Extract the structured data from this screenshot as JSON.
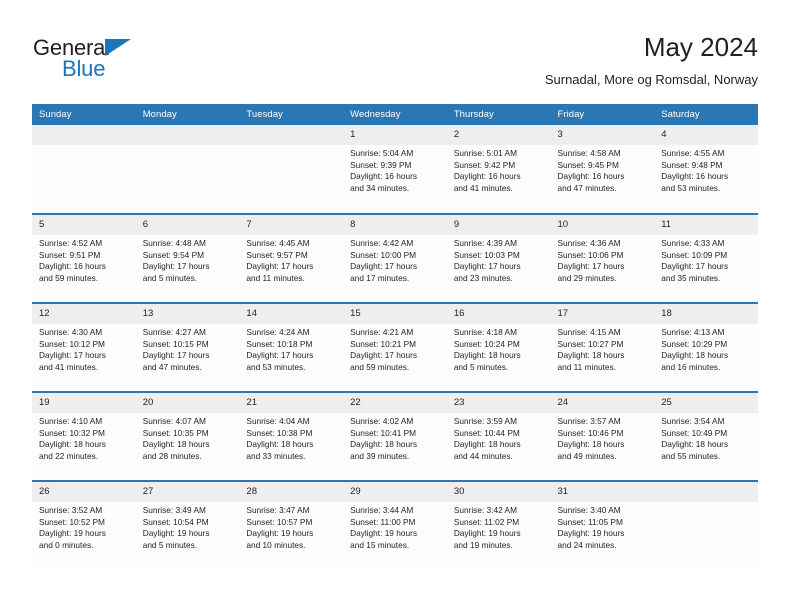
{
  "brand": {
    "word_top": "General",
    "word_bottom": "Blue",
    "accent_color": "#1b75bb"
  },
  "header": {
    "title": "May 2024",
    "subtitle": "Surnadal, More og Romsdal, Norway"
  },
  "theme": {
    "header_blue": "#2b77b4",
    "daynum_gray": "#eeeeee",
    "text": "#231f20"
  },
  "weekday_headers": [
    "Sunday",
    "Monday",
    "Tuesday",
    "Wednesday",
    "Thursday",
    "Friday",
    "Saturday"
  ],
  "labels": {
    "sunrise": "Sunrise:",
    "sunset": "Sunset:",
    "daylight": "Daylight:"
  },
  "weeks": [
    [
      {
        "day": "",
        "empty": true
      },
      {
        "day": "",
        "empty": true
      },
      {
        "day": "",
        "empty": true
      },
      {
        "day": "1",
        "sunrise": "Sunrise: 5:04 AM",
        "sunset": "Sunset: 9:39 PM",
        "daylight1": "Daylight: 16 hours",
        "daylight2": "and 34 minutes."
      },
      {
        "day": "2",
        "sunrise": "Sunrise: 5:01 AM",
        "sunset": "Sunset: 9:42 PM",
        "daylight1": "Daylight: 16 hours",
        "daylight2": "and 41 minutes."
      },
      {
        "day": "3",
        "sunrise": "Sunrise: 4:58 AM",
        "sunset": "Sunset: 9:45 PM",
        "daylight1": "Daylight: 16 hours",
        "daylight2": "and 47 minutes."
      },
      {
        "day": "4",
        "sunrise": "Sunrise: 4:55 AM",
        "sunset": "Sunset: 9:48 PM",
        "daylight1": "Daylight: 16 hours",
        "daylight2": "and 53 minutes."
      }
    ],
    [
      {
        "day": "5",
        "sunrise": "Sunrise: 4:52 AM",
        "sunset": "Sunset: 9:51 PM",
        "daylight1": "Daylight: 16 hours",
        "daylight2": "and 59 minutes."
      },
      {
        "day": "6",
        "sunrise": "Sunrise: 4:48 AM",
        "sunset": "Sunset: 9:54 PM",
        "daylight1": "Daylight: 17 hours",
        "daylight2": "and 5 minutes."
      },
      {
        "day": "7",
        "sunrise": "Sunrise: 4:45 AM",
        "sunset": "Sunset: 9:57 PM",
        "daylight1": "Daylight: 17 hours",
        "daylight2": "and 11 minutes."
      },
      {
        "day": "8",
        "sunrise": "Sunrise: 4:42 AM",
        "sunset": "Sunset: 10:00 PM",
        "daylight1": "Daylight: 17 hours",
        "daylight2": "and 17 minutes."
      },
      {
        "day": "9",
        "sunrise": "Sunrise: 4:39 AM",
        "sunset": "Sunset: 10:03 PM",
        "daylight1": "Daylight: 17 hours",
        "daylight2": "and 23 minutes."
      },
      {
        "day": "10",
        "sunrise": "Sunrise: 4:36 AM",
        "sunset": "Sunset: 10:06 PM",
        "daylight1": "Daylight: 17 hours",
        "daylight2": "and 29 minutes."
      },
      {
        "day": "11",
        "sunrise": "Sunrise: 4:33 AM",
        "sunset": "Sunset: 10:09 PM",
        "daylight1": "Daylight: 17 hours",
        "daylight2": "and 35 minutes."
      }
    ],
    [
      {
        "day": "12",
        "sunrise": "Sunrise: 4:30 AM",
        "sunset": "Sunset: 10:12 PM",
        "daylight1": "Daylight: 17 hours",
        "daylight2": "and 41 minutes."
      },
      {
        "day": "13",
        "sunrise": "Sunrise: 4:27 AM",
        "sunset": "Sunset: 10:15 PM",
        "daylight1": "Daylight: 17 hours",
        "daylight2": "and 47 minutes."
      },
      {
        "day": "14",
        "sunrise": "Sunrise: 4:24 AM",
        "sunset": "Sunset: 10:18 PM",
        "daylight1": "Daylight: 17 hours",
        "daylight2": "and 53 minutes."
      },
      {
        "day": "15",
        "sunrise": "Sunrise: 4:21 AM",
        "sunset": "Sunset: 10:21 PM",
        "daylight1": "Daylight: 17 hours",
        "daylight2": "and 59 minutes."
      },
      {
        "day": "16",
        "sunrise": "Sunrise: 4:18 AM",
        "sunset": "Sunset: 10:24 PM",
        "daylight1": "Daylight: 18 hours",
        "daylight2": "and 5 minutes."
      },
      {
        "day": "17",
        "sunrise": "Sunrise: 4:15 AM",
        "sunset": "Sunset: 10:27 PM",
        "daylight1": "Daylight: 18 hours",
        "daylight2": "and 11 minutes."
      },
      {
        "day": "18",
        "sunrise": "Sunrise: 4:13 AM",
        "sunset": "Sunset: 10:29 PM",
        "daylight1": "Daylight: 18 hours",
        "daylight2": "and 16 minutes."
      }
    ],
    [
      {
        "day": "19",
        "sunrise": "Sunrise: 4:10 AM",
        "sunset": "Sunset: 10:32 PM",
        "daylight1": "Daylight: 18 hours",
        "daylight2": "and 22 minutes."
      },
      {
        "day": "20",
        "sunrise": "Sunrise: 4:07 AM",
        "sunset": "Sunset: 10:35 PM",
        "daylight1": "Daylight: 18 hours",
        "daylight2": "and 28 minutes."
      },
      {
        "day": "21",
        "sunrise": "Sunrise: 4:04 AM",
        "sunset": "Sunset: 10:38 PM",
        "daylight1": "Daylight: 18 hours",
        "daylight2": "and 33 minutes."
      },
      {
        "day": "22",
        "sunrise": "Sunrise: 4:02 AM",
        "sunset": "Sunset: 10:41 PM",
        "daylight1": "Daylight: 18 hours",
        "daylight2": "and 39 minutes."
      },
      {
        "day": "23",
        "sunrise": "Sunrise: 3:59 AM",
        "sunset": "Sunset: 10:44 PM",
        "daylight1": "Daylight: 18 hours",
        "daylight2": "and 44 minutes."
      },
      {
        "day": "24",
        "sunrise": "Sunrise: 3:57 AM",
        "sunset": "Sunset: 10:46 PM",
        "daylight1": "Daylight: 18 hours",
        "daylight2": "and 49 minutes."
      },
      {
        "day": "25",
        "sunrise": "Sunrise: 3:54 AM",
        "sunset": "Sunset: 10:49 PM",
        "daylight1": "Daylight: 18 hours",
        "daylight2": "and 55 minutes."
      }
    ],
    [
      {
        "day": "26",
        "sunrise": "Sunrise: 3:52 AM",
        "sunset": "Sunset: 10:52 PM",
        "daylight1": "Daylight: 19 hours",
        "daylight2": "and 0 minutes."
      },
      {
        "day": "27",
        "sunrise": "Sunrise: 3:49 AM",
        "sunset": "Sunset: 10:54 PM",
        "daylight1": "Daylight: 19 hours",
        "daylight2": "and 5 minutes."
      },
      {
        "day": "28",
        "sunrise": "Sunrise: 3:47 AM",
        "sunset": "Sunset: 10:57 PM",
        "daylight1": "Daylight: 19 hours",
        "daylight2": "and 10 minutes."
      },
      {
        "day": "29",
        "sunrise": "Sunrise: 3:44 AM",
        "sunset": "Sunset: 11:00 PM",
        "daylight1": "Daylight: 19 hours",
        "daylight2": "and 15 minutes."
      },
      {
        "day": "30",
        "sunrise": "Sunrise: 3:42 AM",
        "sunset": "Sunset: 11:02 PM",
        "daylight1": "Daylight: 19 hours",
        "daylight2": "and 19 minutes."
      },
      {
        "day": "31",
        "sunrise": "Sunrise: 3:40 AM",
        "sunset": "Sunset: 11:05 PM",
        "daylight1": "Daylight: 19 hours",
        "daylight2": "and 24 minutes."
      },
      {
        "day": "",
        "empty": true
      }
    ]
  ]
}
